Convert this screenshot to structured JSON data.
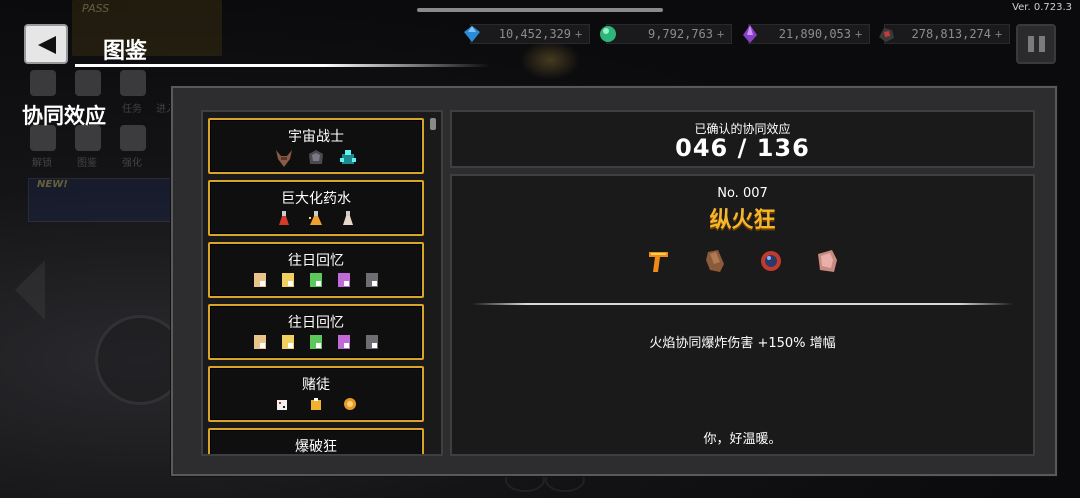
{
  "version": "Ver. 0.723.3",
  "header": {
    "title": "图鉴",
    "section": "协同效应"
  },
  "currencies": [
    {
      "icon": "diamond-icon",
      "value": "10,452,329",
      "color": "#2a8bd8"
    },
    {
      "icon": "green-orb-icon",
      "value": "9,792,763",
      "color": "#2db67a"
    },
    {
      "icon": "purple-crystal-icon",
      "value": "21,890,053",
      "color": "#8a3fc9"
    },
    {
      "icon": "red-ore-icon",
      "value": "278,813,274",
      "color": "#c93a3a"
    }
  ],
  "dim_menu": {
    "labels": [
      "解锁",
      "图鉴",
      "强化",
      "任务",
      "进入"
    ]
  },
  "pass_label": "PASS",
  "new_label": "NEW!",
  "synergy_list": [
    {
      "name": "宇宙战士",
      "items": [
        "horned-helmet-icon",
        "dark-armor-icon",
        "cyan-crystal-icon"
      ]
    },
    {
      "name": "巨大化药水",
      "items": [
        "red-potion-icon",
        "orange-potion-icon",
        "white-potion-icon"
      ]
    },
    {
      "name": "往日回忆",
      "items": [
        "tan-scroll-icon",
        "yellow-scroll-icon",
        "green-scroll-icon",
        "purple-scroll-icon",
        "gray-scroll-icon"
      ]
    },
    {
      "name": "往日回忆",
      "items": [
        "tan-scroll-icon",
        "yellow-scroll-icon",
        "green-scroll-icon",
        "purple-scroll-icon",
        "gray-scroll-icon"
      ]
    },
    {
      "name": "赌徒",
      "items": [
        "dice-icon",
        "pouch-icon",
        "coin-icon"
      ]
    },
    {
      "name": "爆破狂",
      "items": []
    }
  ],
  "confirmed": {
    "label": "已确认的协同效应",
    "value": "046 / 136"
  },
  "detail": {
    "number": "No. 007",
    "name": "纵火狂",
    "items": [
      "fire-boomerang-icon",
      "brown-glove-icon",
      "fire-orb-icon",
      "raw-meat-icon"
    ],
    "effect": "火焰协同爆炸伤害 +150% 增幅",
    "flavor": "你，好温暖。"
  },
  "colors": {
    "card_border": "#d9a526",
    "name_accent": "#f7b52b"
  }
}
